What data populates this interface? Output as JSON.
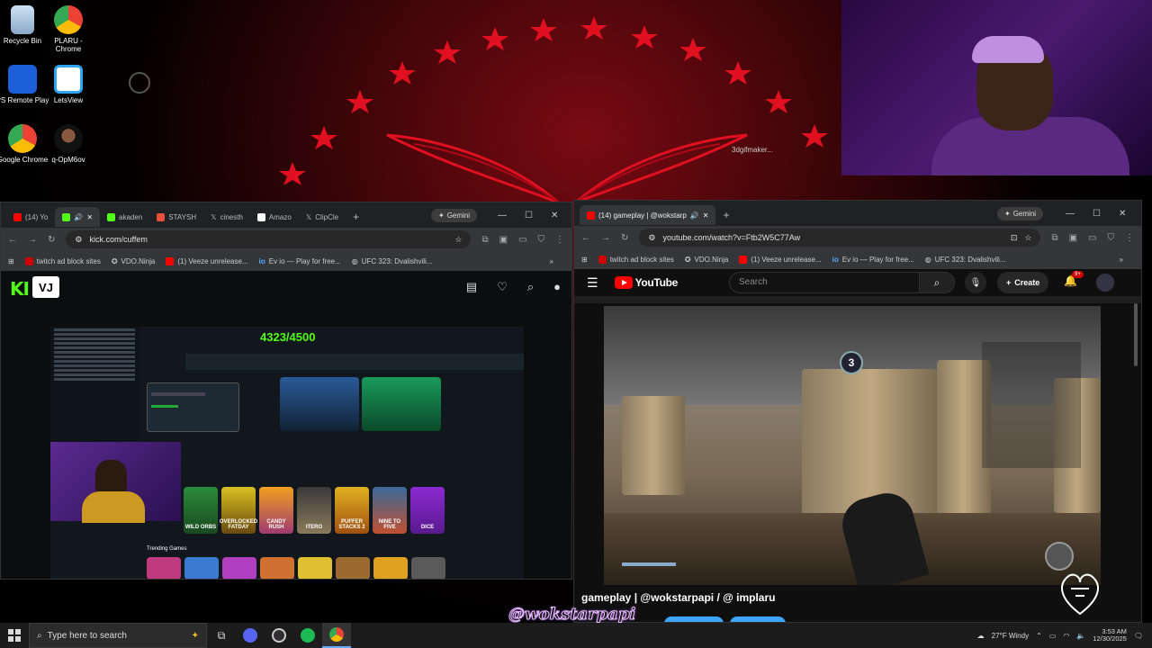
{
  "desktop": {
    "icons": [
      {
        "label": "Recycle Bin"
      },
      {
        "label": "PLARU - Chrome"
      },
      {
        "label": "PS Remote Play"
      },
      {
        "label": "LetsView"
      },
      {
        "label": "Google Chrome"
      },
      {
        "label": "q-OpM6ov"
      }
    ],
    "watermark_text": "3dgifmaker..."
  },
  "left_browser": {
    "tabs": [
      {
        "label": "(14) Yo",
        "color": "#ff0000"
      },
      {
        "label": "",
        "color": "#53fc18",
        "active": true
      },
      {
        "label": "akaden",
        "color": "#53fc18"
      },
      {
        "label": "STAYSH",
        "color": "#e8503a"
      },
      {
        "label": "cinesth",
        "color": "#ffffff"
      },
      {
        "label": "Amazo",
        "color": "#ffffff"
      },
      {
        "label": "ClipCle",
        "color": "#ffffff"
      }
    ],
    "gemini_label": "Gemini",
    "url": "kick.com/cuffem",
    "bookmarks": [
      "twitch ad block sites",
      "VDO.Ninja",
      "(1) Veeze unrelease...",
      "Ev io — Play for free...",
      "UFC 323: Dvalishvili..."
    ]
  },
  "kick": {
    "logo": "KI",
    "vj_badge": "VJ",
    "counter": "4323/4500",
    "games": [
      "WILD ORBS",
      "OVERLOCKED FATDAY",
      "CANDY RUSH",
      "ITERO",
      "PUFFER STACKS 2",
      "NINE TO FIVE",
      "DICE"
    ],
    "trending_label": "Trending Games"
  },
  "right_browser": {
    "tab_label": "(14) gameplay | @wokstarp",
    "gemini_label": "Gemini",
    "url": "youtube.com/watch?v=Ftb2W5C77Aw",
    "bookmarks": [
      "twitch ad block sites",
      "VDO.Ninja",
      "(1) Veeze unrelease...",
      "Ev io — Play for free...",
      "UFC 323: Dvalishvili..."
    ]
  },
  "youtube": {
    "logo_text": "YouTube",
    "search_placeholder": "Search",
    "create_label": "Create",
    "notif_count": "9+",
    "video_title": "gameplay | @wokstarpapi / @ implaru",
    "hud_number": "3"
  },
  "taskbar": {
    "search_placeholder": "Type here to search",
    "weather": "27°F  Windy",
    "time": "3:53 AM",
    "date": "12/30/2025"
  },
  "overlay": {
    "streamer_handle": "@wokstarpapi"
  }
}
